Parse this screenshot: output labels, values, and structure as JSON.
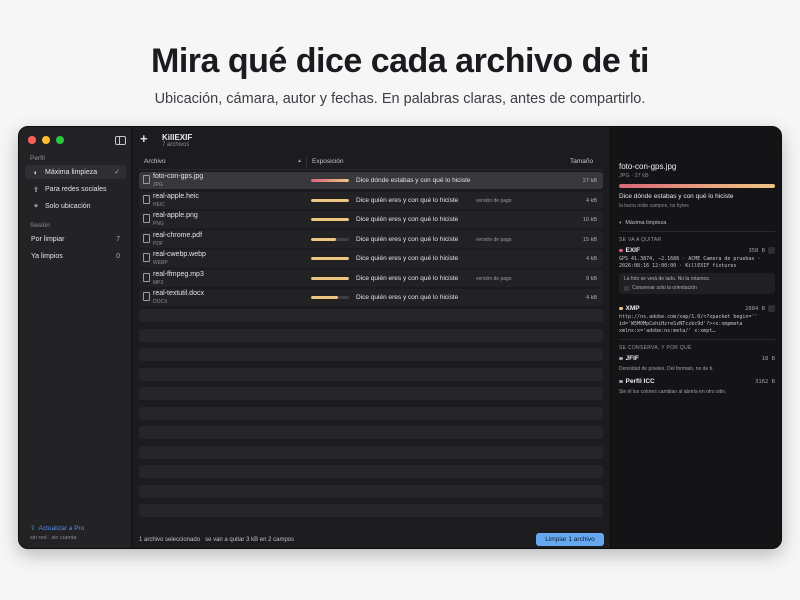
{
  "hero": {
    "title": "Mira qué dice cada archivo de ti",
    "subtitle": "Ubicación, cámara, autor y fechas. En palabras claras, antes de compartirlo."
  },
  "sidebar": {
    "profile_label": "Perfil",
    "profiles": [
      {
        "label": "Máxima limpieza",
        "icon": "shield-icon",
        "selected": true
      },
      {
        "label": "Para redes sociales",
        "icon": "share-icon",
        "selected": false
      },
      {
        "label": "Solo ubicación",
        "icon": "location-icon",
        "selected": false
      }
    ],
    "session_label": "Sesión",
    "session_items": [
      {
        "label": "Por limpiar",
        "count": "7"
      },
      {
        "label": "Ya limpios",
        "count": "0"
      }
    ],
    "upgrade_label": "Actualizar a Pro",
    "network_status": "sin red · sin cuenta"
  },
  "main": {
    "app_title": "KillEXIF",
    "app_subtitle": "7 archivos",
    "columns": {
      "file": "Archivo",
      "exposure": "Exposición",
      "size": "Tamaño"
    },
    "files": [
      {
        "name": "foto-con-gps.jpg",
        "type": "JPG",
        "exposure": "Dice dónde estabas y con qué lo hiciste",
        "level": 1.0,
        "badge": "",
        "size": "27 kB",
        "selected": true
      },
      {
        "name": "real-apple.heic",
        "type": "HEIC",
        "exposure": "Dice quién eres y con qué lo hiciste",
        "level": 1.0,
        "badge": "versión de pago",
        "size": "4 kB",
        "selected": false
      },
      {
        "name": "real-apple.png",
        "type": "PNG",
        "exposure": "Dice quién eres y con qué lo hiciste",
        "level": 1.0,
        "badge": "",
        "size": "10 kB",
        "selected": false
      },
      {
        "name": "real-chrome.pdf",
        "type": "PDF",
        "exposure": "Dice quién eres y con qué lo hiciste",
        "level": 0.65,
        "badge": "versión de pago",
        "size": "15 kB",
        "selected": false
      },
      {
        "name": "real-cwebp.webp",
        "type": "WEBP",
        "exposure": "Dice quién eres y con qué lo hiciste",
        "level": 1.0,
        "badge": "",
        "size": "4 kB",
        "selected": false
      },
      {
        "name": "real-ffmpeg.mp3",
        "type": "MP3",
        "exposure": "Dice quién eres y con qué lo hiciste",
        "level": 1.0,
        "badge": "versión de pago",
        "size": "9 kB",
        "selected": false
      },
      {
        "name": "real-textutil.docx",
        "type": "DOCX",
        "exposure": "Dice quién eres y con qué lo hiciste",
        "level": 0.7,
        "badge": "",
        "size": "4 kB",
        "selected": false
      }
    ],
    "status_selected": "1 archivo seleccionado",
    "status_removed": "se van a quitar 3 kB en 2 campos",
    "clean_button": "Limpiar 1 archivo"
  },
  "inspector": {
    "file_name": "foto-con-gps.jpg",
    "file_meta": "JPG · 27 kB",
    "exposure": "Dice dónde estabas y con qué lo hiciste",
    "note": "la barra mide campos, no bytes",
    "profile": "Máxima limpieza",
    "remove_section": "SE VA A QUITAR",
    "exif": {
      "title": "EXIF",
      "size": "358 B",
      "lines": "GPS 41.3874, −2.1686 · ACME Camera de pruebas ·\n2026:08:16 12:00:00 · KillEXIF fixtures",
      "warning": "La foto se verá de lado. No la rotamos.",
      "keep_orientation": "Conservar solo la orientación"
    },
    "xmp": {
      "title": "XMP",
      "size": "2884 B",
      "lines": "http://ns.adobe.com/xap/1.0/<?xpacket begin=''\nid='W5M0MpCehiHzreSzNTczkc9d'?><x:xmpmeta\nxmlns:x='adobe:ns:meta/' x:xmpt…"
    },
    "keep_section": "SE CONSERVA, Y POR QUÉ",
    "jfif": {
      "title": "JFIF",
      "size": "18 B",
      "desc": "Densidad de píxeles. Del formato, no de ti."
    },
    "icc": {
      "title": "Perfil ICC",
      "size": "3162 B",
      "desc": "Sin él los colores cambian al abrirla en otro sitio."
    }
  },
  "colors": {
    "accent": "#66a8f0",
    "danger": "#d9667a",
    "warning": "#ecc780",
    "keep": "#a3a3aa"
  }
}
